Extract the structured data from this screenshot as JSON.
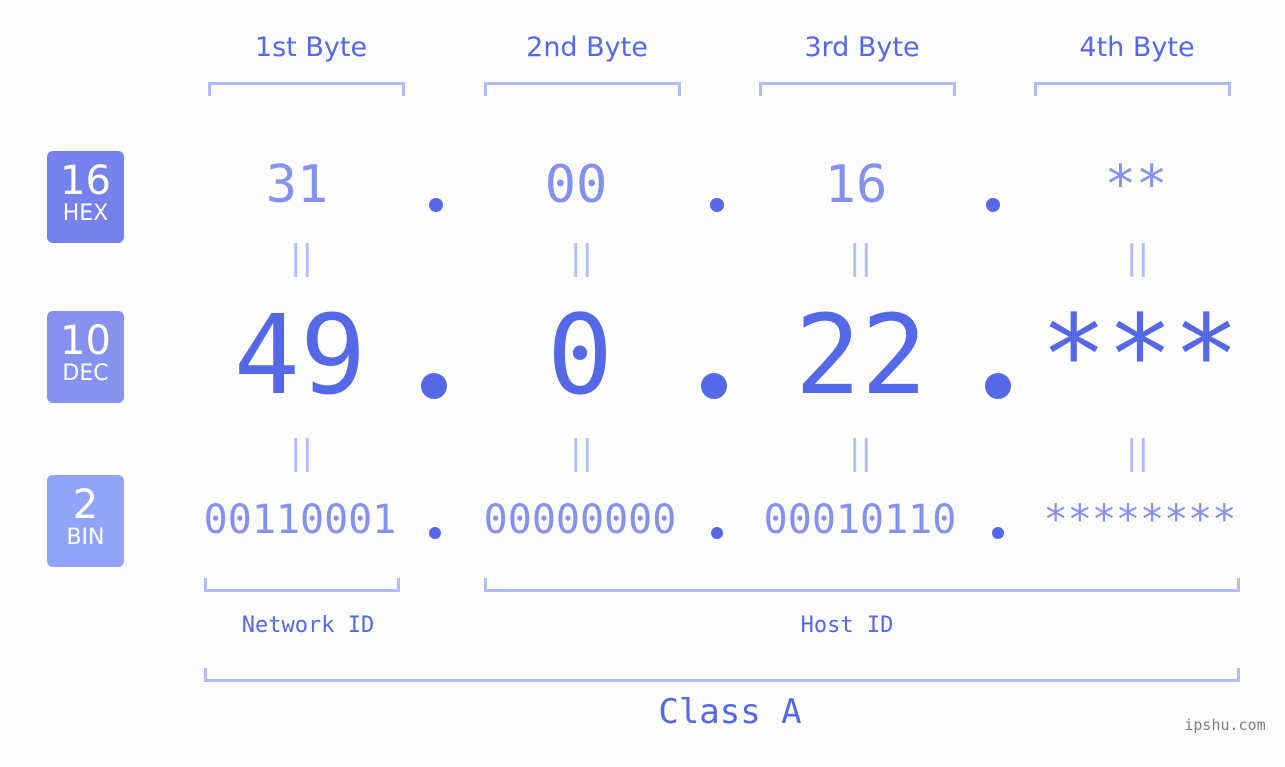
{
  "headers": [
    "1st Byte",
    "2nd Byte",
    "3rd Byte",
    "4th Byte"
  ],
  "badges": {
    "hex": {
      "num": "16",
      "label": "HEX",
      "color": "#7581ec"
    },
    "dec": {
      "num": "10",
      "label": "DEC",
      "color": "#8592f0"
    },
    "bin": {
      "num": "2",
      "label": "BIN",
      "color": "#90a4f8"
    }
  },
  "hex": [
    "31",
    "00",
    "16",
    "**"
  ],
  "dec": [
    "49",
    "0",
    "22",
    "***"
  ],
  "bin": [
    "00110001",
    "00000000",
    "00010110",
    "********"
  ],
  "separator": ".",
  "equals": "||",
  "network_label": "Network ID",
  "host_label": "Host ID",
  "class_label": "Class A",
  "watermark": "ipshu.com",
  "colors": {
    "primary": "#5468e8",
    "secondary": "#8591ee",
    "bracket": "#b3bcf6",
    "background": "#fcfdfc"
  }
}
